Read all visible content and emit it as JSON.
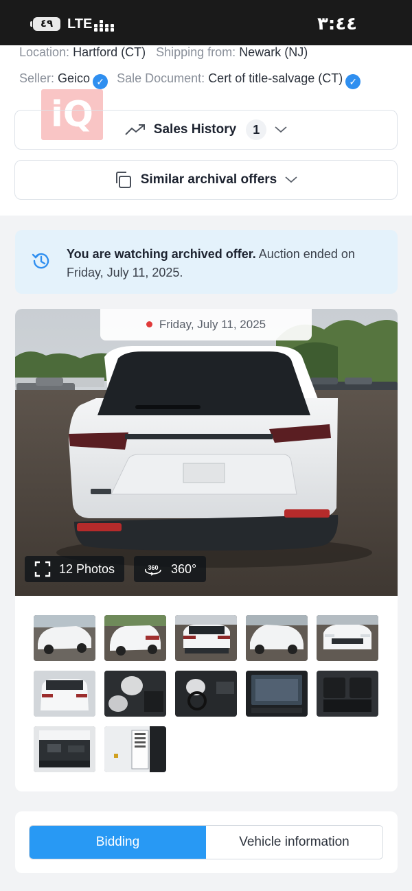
{
  "status_bar": {
    "battery": "٤٩",
    "network": "LTE",
    "time": "٣:٤٤"
  },
  "details": {
    "location_label": "Location:",
    "location_value": "Hartford (CT)",
    "shipping_label": "Shipping from:",
    "shipping_value": "Newark (NJ)",
    "seller_label": "Seller:",
    "seller_value": "Geico",
    "document_label": "Sale Document:",
    "document_value": "Cert of title-salvage (CT)"
  },
  "watermark_text": "iQ",
  "sales_history": {
    "label": "Sales History",
    "count": "1"
  },
  "similar_offers": {
    "label": "Similar archival offers"
  },
  "archived_notice": {
    "strong": "You are watching archived offer.",
    "rest": " Auction ended on Friday, July 11, 2025."
  },
  "gallery": {
    "date": "Friday, July 11, 2025",
    "photos_count_label": "12 Photos",
    "view_360_label": "360°",
    "thumbnails": [
      "exterior-front-left",
      "exterior-rear-left",
      "exterior-rear",
      "exterior-front-right",
      "exterior-front",
      "exterior-rear-top",
      "interior-airbags-front",
      "interior-dashboard",
      "interior-infotainment-screen",
      "interior-rear-seats",
      "engine-bay",
      "door-label"
    ]
  },
  "tabs": {
    "bidding": "Bidding",
    "vehicle_info": "Vehicle information"
  },
  "colors": {
    "accent": "#2899f4",
    "verified": "#2f8ff0",
    "notice_bg": "#e4f2fb",
    "live_dot": "#e03a3a"
  }
}
